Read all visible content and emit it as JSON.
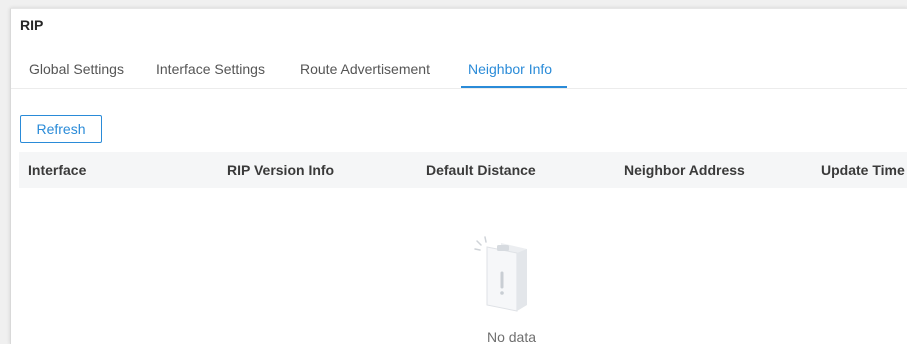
{
  "page": {
    "title": "RIP"
  },
  "tabs": [
    {
      "label": "Global Settings",
      "active": false
    },
    {
      "label": "Interface Settings",
      "active": false
    },
    {
      "label": "Route Advertisement",
      "active": false
    },
    {
      "label": "Neighbor Info",
      "active": true
    }
  ],
  "toolbar": {
    "refresh_label": "Refresh"
  },
  "table": {
    "columns": [
      "Interface",
      "RIP Version Info",
      "Default Distance",
      "Neighbor Address",
      "Update Time"
    ],
    "rows": [],
    "empty_text": "No data"
  },
  "icons": {
    "empty": "empty-clipboard-icon"
  },
  "colors": {
    "accent": "#2a8bd8",
    "header_bg": "#f5f6f7",
    "text": "#3a3a3a"
  }
}
